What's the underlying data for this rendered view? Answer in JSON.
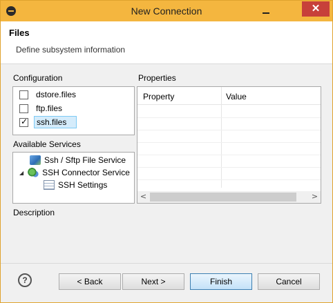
{
  "window": {
    "title": "New Connection",
    "close_glyph": "✕"
  },
  "header": {
    "title": "Files",
    "subtitle": "Define subsystem information"
  },
  "configuration": {
    "label": "Configuration",
    "items": [
      {
        "label": "dstore.files",
        "checked": false
      },
      {
        "label": "ftp.files",
        "checked": false
      },
      {
        "label": "ssh.files",
        "checked": true,
        "selected": true
      }
    ]
  },
  "services": {
    "label": "Available Services",
    "items": [
      {
        "label": "Ssh / Sftp File Service",
        "icon": "file-service-icon"
      },
      {
        "label": "SSH Connector Service",
        "icon": "connector-service-icon",
        "expanded": true
      },
      {
        "label": "SSH Settings",
        "icon": "settings-table-icon"
      }
    ]
  },
  "properties": {
    "label": "Properties",
    "columns": [
      "Property",
      "Value"
    ],
    "scroll_left": "<",
    "scroll_right": ">"
  },
  "description": {
    "label": "Description"
  },
  "buttons": {
    "help": "?",
    "back": "< Back",
    "next": "Next >",
    "finish": "Finish",
    "cancel": "Cancel"
  }
}
